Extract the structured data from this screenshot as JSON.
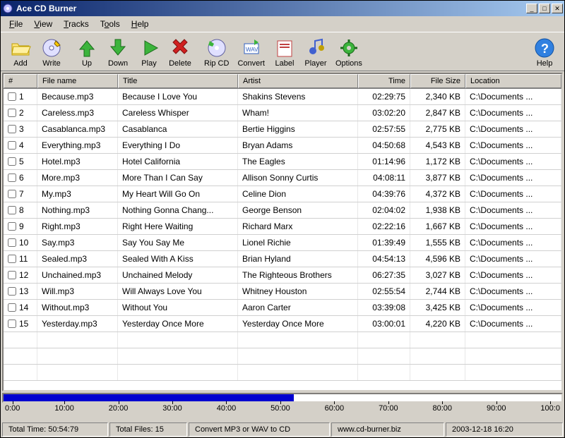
{
  "window": {
    "title": "Ace CD Burner"
  },
  "menubar": [
    {
      "key": "F",
      "rest": "ile"
    },
    {
      "key": "V",
      "rest": "iew"
    },
    {
      "key": "T",
      "rest": "racks"
    },
    {
      "key": "T",
      "rest": "ools",
      "key2": "T"
    },
    {
      "key": "H",
      "rest": "elp"
    }
  ],
  "menu_labels": [
    "File",
    "View",
    "Tracks",
    "Tools",
    "Help"
  ],
  "toolbar": {
    "add": "Add",
    "write": "Write",
    "up": "Up",
    "down": "Down",
    "play": "Play",
    "delete": "Delete",
    "rip": "Rip CD",
    "convert": "Convert",
    "label": "Label",
    "player": "Player",
    "options": "Options",
    "help": "Help"
  },
  "columns": {
    "num": "#",
    "file": "File name",
    "title": "Title",
    "artist": "Artist",
    "time": "Time",
    "size": "File Size",
    "loc": "Location"
  },
  "tracks": [
    {
      "n": "1",
      "file": "Because.mp3",
      "title": "Because I Love You",
      "artist": "Shakins Stevens",
      "time": "02:29:75",
      "size": "2,340 KB",
      "loc": "C:\\Documents ..."
    },
    {
      "n": "2",
      "file": "Careless.mp3",
      "title": "Careless Whisper",
      "artist": "Wham!",
      "time": "03:02:20",
      "size": "2,847 KB",
      "loc": "C:\\Documents ..."
    },
    {
      "n": "3",
      "file": "Casablanca.mp3",
      "title": "Casablanca",
      "artist": "Bertie Higgins",
      "time": "02:57:55",
      "size": "2,775 KB",
      "loc": "C:\\Documents ..."
    },
    {
      "n": "4",
      "file": "Everything.mp3",
      "title": "Everything I Do",
      "artist": "Bryan Adams",
      "time": "04:50:68",
      "size": "4,543 KB",
      "loc": "C:\\Documents ..."
    },
    {
      "n": "5",
      "file": "Hotel.mp3",
      "title": "Hotel California",
      "artist": "The Eagles",
      "time": "01:14:96",
      "size": "1,172 KB",
      "loc": "C:\\Documents ..."
    },
    {
      "n": "6",
      "file": "More.mp3",
      "title": "More Than I Can Say",
      "artist": "Allison Sonny Curtis",
      "time": "04:08:11",
      "size": "3,877 KB",
      "loc": "C:\\Documents ..."
    },
    {
      "n": "7",
      "file": "My.mp3",
      "title": "My Heart Will Go On",
      "artist": "Celine Dion",
      "time": "04:39:76",
      "size": "4,372 KB",
      "loc": "C:\\Documents ..."
    },
    {
      "n": "8",
      "file": "Nothing.mp3",
      "title": "Nothing Gonna Chang...",
      "artist": "George Benson",
      "time": "02:04:02",
      "size": "1,938 KB",
      "loc": "C:\\Documents ..."
    },
    {
      "n": "9",
      "file": "Right.mp3",
      "title": "Right Here Waiting",
      "artist": "Richard Marx",
      "time": "02:22:16",
      "size": "1,667 KB",
      "loc": "C:\\Documents ..."
    },
    {
      "n": "10",
      "file": "Say.mp3",
      "title": "Say You Say Me",
      "artist": "Lionel Richie",
      "time": "01:39:49",
      "size": "1,555 KB",
      "loc": "C:\\Documents ..."
    },
    {
      "n": "11",
      "file": "Sealed.mp3",
      "title": "Sealed With A Kiss",
      "artist": "Brian Hyland",
      "time": "04:54:13",
      "size": "4,596 KB",
      "loc": "C:\\Documents ..."
    },
    {
      "n": "12",
      "file": "Unchained.mp3",
      "title": "Unchained Melody",
      "artist": "The Righteous Brothers",
      "time": "06:27:35",
      "size": "3,027 KB",
      "loc": "C:\\Documents ..."
    },
    {
      "n": "13",
      "file": "Will.mp3",
      "title": "Will Always Love You",
      "artist": "Whitney Houston",
      "time": "02:55:54",
      "size": "2,744 KB",
      "loc": "C:\\Documents ..."
    },
    {
      "n": "14",
      "file": "Without.mp3",
      "title": "Without You",
      "artist": "Aaron Carter",
      "time": "03:39:08",
      "size": "3,425 KB",
      "loc": "C:\\Documents ..."
    },
    {
      "n": "15",
      "file": "Yesterday.mp3",
      "title": "Yesterday Once More",
      "artist": "Yesterday Once More",
      "time": "03:00:01",
      "size": "4,220 KB",
      "loc": "C:\\Documents ..."
    }
  ],
  "progress_percent": 52,
  "ruler_ticks": [
    "0:00",
    "10:00",
    "20:00",
    "30:00",
    "40:00",
    "50:00",
    "60:00",
    "70:00",
    "80:00",
    "90:00",
    "100:0"
  ],
  "status": {
    "total_time": "Total Time: 50:54:79",
    "total_files": "Total Files: 15",
    "mode": "Convert MP3 or WAV to CD",
    "url": "www.cd-burner.biz",
    "date": "2003-12-18   16:20"
  }
}
